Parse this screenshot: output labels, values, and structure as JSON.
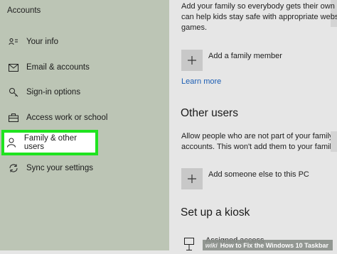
{
  "sidebar": {
    "title": "Accounts",
    "items": [
      {
        "label": "Your info",
        "icon": "person-card-icon"
      },
      {
        "label": "Email & accounts",
        "icon": "mail-icon"
      },
      {
        "label": "Sign-in options",
        "icon": "key-icon"
      },
      {
        "label": "Access work or school",
        "icon": "briefcase-icon"
      },
      {
        "label": "Family & other users",
        "icon": "person-icon"
      },
      {
        "label": "Sync your settings",
        "icon": "sync-icon"
      }
    ]
  },
  "main": {
    "family_description": [
      "Add your family so everybody gets their own sig",
      "can help kids stay safe with appropriate website",
      "games."
    ],
    "add_family_label": "Add a family member",
    "learn_more": "Learn more",
    "other_users_title": "Other users",
    "other_users_description": [
      "Allow people who are not part of your family to",
      "accounts. This won't add them to your family."
    ],
    "add_someone_label": "Add someone else to this PC",
    "kiosk_title": "Set up a kiosk",
    "assigned_access_label": "Assigned access"
  },
  "watermark": {
    "logo": "wiki",
    "text": "How to Fix the Windows 10 Taskbar"
  },
  "colors": {
    "sidebar_bg": "#bcc5b5",
    "main_bg": "#e6e6e6",
    "highlight_border": "#1fe31f",
    "link": "#1b5db3"
  }
}
